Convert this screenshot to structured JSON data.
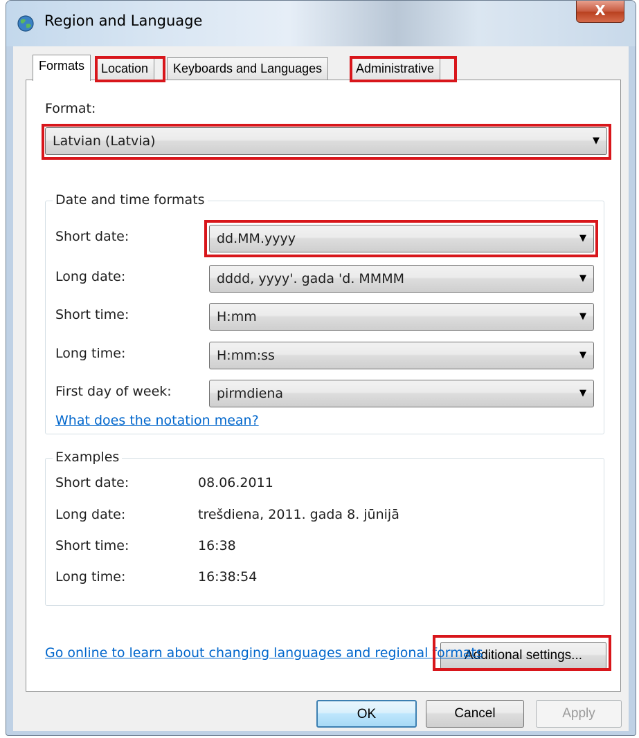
{
  "window": {
    "title": "Region and Language",
    "close_glyph": "X"
  },
  "tabs": [
    {
      "label": "Formats",
      "active": true
    },
    {
      "label": "Location",
      "active": false
    },
    {
      "label": "Keyboards and Languages",
      "active": false
    },
    {
      "label": "Administrative",
      "active": false
    }
  ],
  "format": {
    "label": "Format:",
    "value": "Latvian (Latvia)"
  },
  "date_time_formats": {
    "title": "Date and time formats",
    "rows": [
      {
        "label": "Short date:",
        "value": "dd.MM.yyyy"
      },
      {
        "label": "Long date:",
        "value": "dddd, yyyy'. gada 'd. MMMM"
      },
      {
        "label": "Short time:",
        "value": "H:mm"
      },
      {
        "label": "Long time:",
        "value": "H:mm:ss"
      },
      {
        "label": "First day of week:",
        "value": "pirmdiena"
      }
    ],
    "notation_link": "What does the notation mean?"
  },
  "examples": {
    "title": "Examples",
    "rows": [
      {
        "label": "Short date:",
        "value": "08.06.2011"
      },
      {
        "label": "Long date:",
        "value": "trešdiena, 2011. gada 8. jūnijā"
      },
      {
        "label": "Short time:",
        "value": "16:38"
      },
      {
        "label": "Long time:",
        "value": "16:38:54"
      }
    ]
  },
  "additional_settings_label": "Additional settings...",
  "online_link": "Go online to learn about changing languages and regional formats",
  "buttons": {
    "ok": "OK",
    "cancel": "Cancel",
    "apply": "Apply"
  },
  "colors": {
    "highlight": "#d8161b",
    "link": "#0066cc"
  },
  "icons": {
    "app": "globe-icon",
    "dropdown": "chevron-down-icon"
  }
}
